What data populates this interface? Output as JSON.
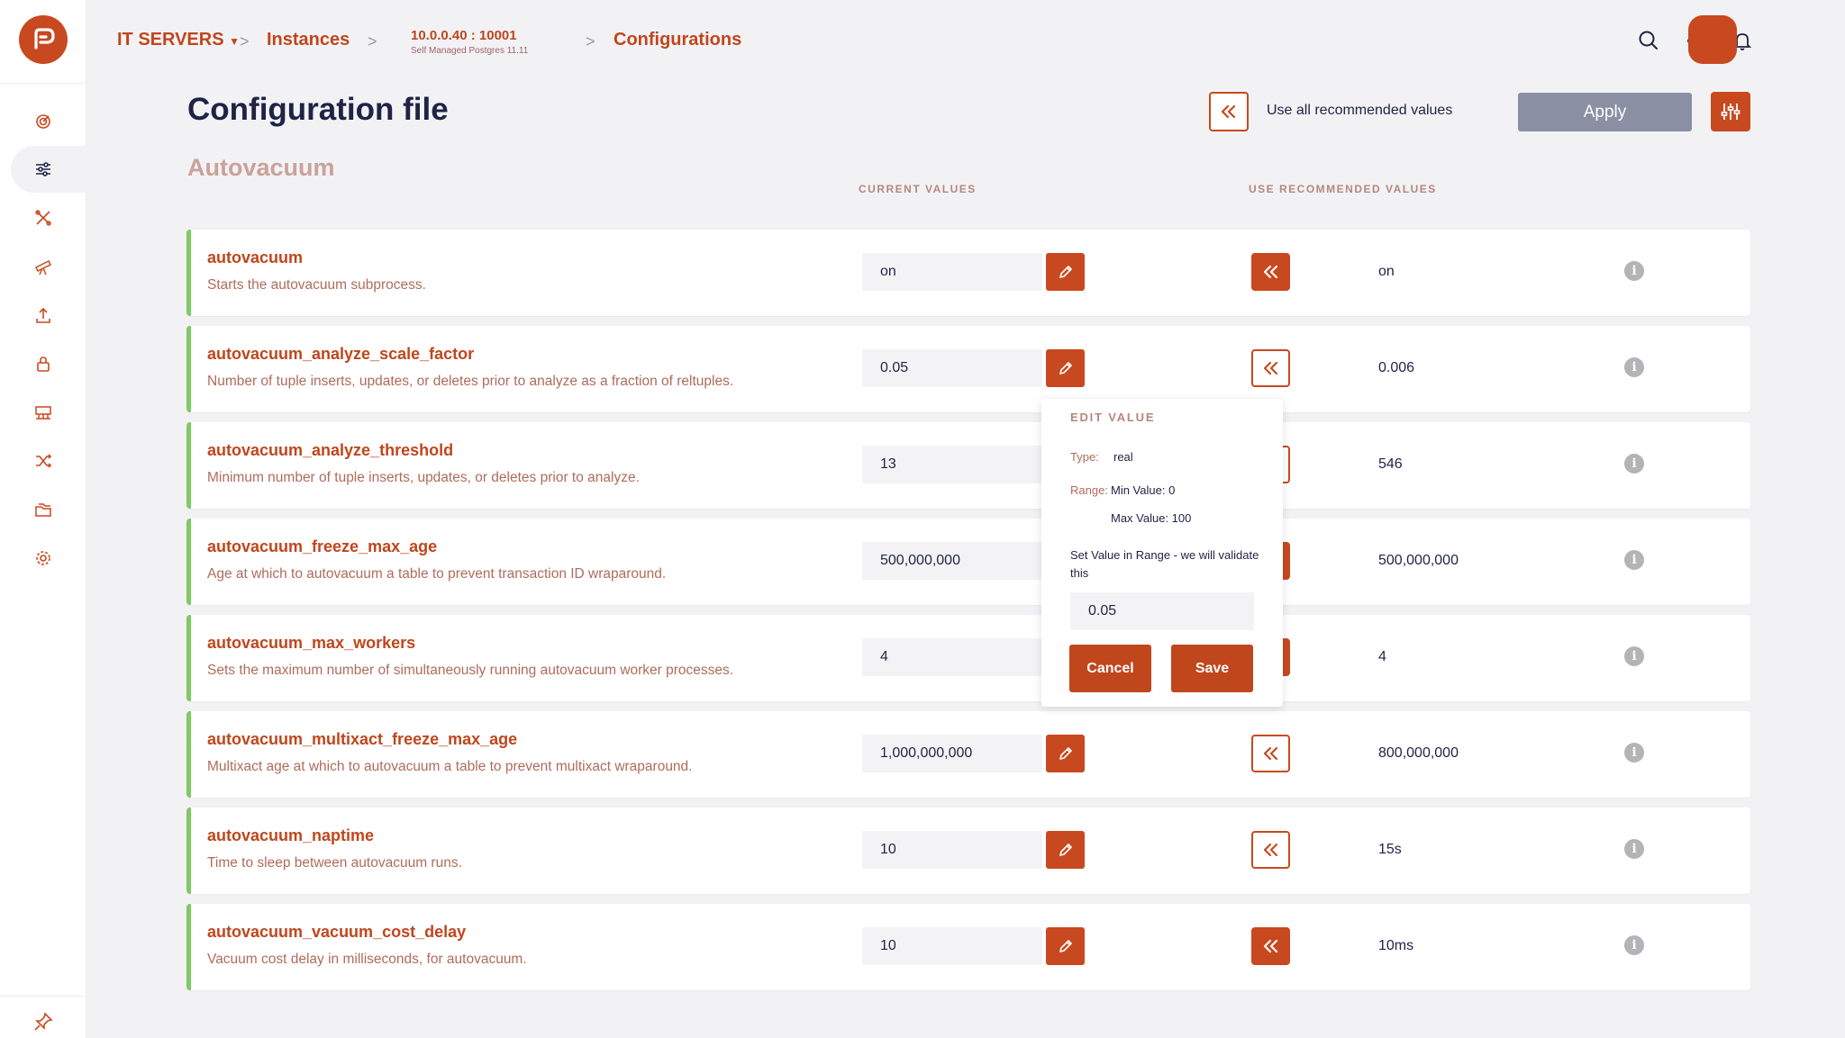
{
  "colors": {
    "accent": "#c8491f",
    "row_border": "#7dcb62",
    "apply_bg": "#8a8fa3"
  },
  "breadcrumb": {
    "org": "IT SERVERS",
    "instances": "Instances",
    "instance_main": "10.0.0.40 : 10001",
    "instance_sub": "Self Managed Postgres 11.11",
    "configurations": "Configurations"
  },
  "page": {
    "title": "Configuration file",
    "use_all_label": "Use all recommended values",
    "apply_label": "Apply",
    "section_title": "Autovacuum",
    "col_current": "CURRENT VALUES",
    "col_recommended": "USE RECOMMENDED VALUES"
  },
  "sidebar": {
    "items": [
      {
        "icon": "dashboard-gauge-icon"
      },
      {
        "icon": "sliders-icon",
        "active": true
      },
      {
        "icon": "tools-icon"
      },
      {
        "icon": "telescope-icon"
      },
      {
        "icon": "upload-icon"
      },
      {
        "icon": "lock-icon"
      },
      {
        "icon": "server-icon"
      },
      {
        "icon": "shuffle-icon"
      },
      {
        "icon": "folders-icon"
      },
      {
        "icon": "gear-icon"
      }
    ],
    "bottom_icon": "pin-icon"
  },
  "params": [
    {
      "name": "autovacuum",
      "desc": "Starts the autovacuum subprocess.",
      "current": "on",
      "recommended": "on",
      "use_filled": true
    },
    {
      "name": "autovacuum_analyze_scale_factor",
      "desc": "Number of tuple inserts, updates, or deletes prior to analyze as a fraction of reltuples.",
      "current": "0.05",
      "recommended": "0.006",
      "use_filled": false
    },
    {
      "name": "autovacuum_analyze_threshold",
      "desc": "Minimum number of tuple inserts, updates, or deletes prior to analyze.",
      "current": "13",
      "recommended": "546",
      "use_filled": false
    },
    {
      "name": "autovacuum_freeze_max_age",
      "desc": "Age at which to autovacuum a table to prevent transaction ID wraparound.",
      "current": "500,000,000",
      "recommended": "500,000,000",
      "use_filled": true
    },
    {
      "name": "autovacuum_max_workers",
      "desc": "Sets the maximum number of simultaneously running autovacuum worker processes.",
      "current": "4",
      "recommended": "4",
      "use_filled": true
    },
    {
      "name": "autovacuum_multixact_freeze_max_age",
      "desc": "Multixact age at which to autovacuum a table to prevent multixact wraparound.",
      "current": "1,000,000,000",
      "recommended": "800,000,000",
      "use_filled": false
    },
    {
      "name": "autovacuum_naptime",
      "desc": "Time to sleep between autovacuum runs.",
      "current": "10",
      "recommended": "15s",
      "use_filled": false
    },
    {
      "name": "autovacuum_vacuum_cost_delay",
      "desc": "Vacuum cost delay in milliseconds, for autovacuum.",
      "current": "10",
      "recommended": "10ms",
      "use_filled": true
    }
  ],
  "popup": {
    "title": "EDIT VALUE",
    "type_label": "Type:",
    "type_value": "real",
    "range_label": "Range:",
    "min_value": "Min Value: 0",
    "max_value": "Max Value: 100",
    "prompt": "Set Value in Range - we will validate this",
    "value": "0.05",
    "cancel_label": "Cancel",
    "save_label": "Save"
  }
}
